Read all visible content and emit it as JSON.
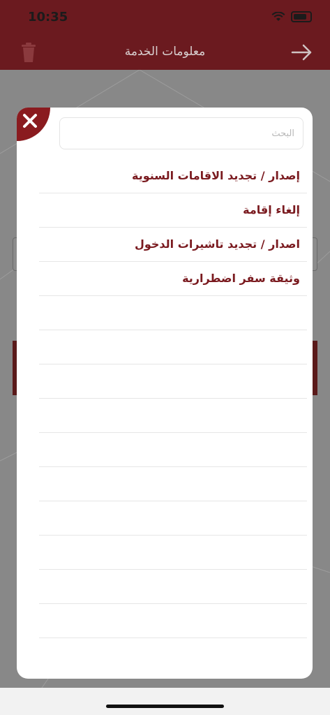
{
  "status_bar": {
    "time": "10:35"
  },
  "navbar": {
    "title": "معلومات الخدمة"
  },
  "modal": {
    "search_placeholder": "البحث",
    "items": [
      "إصدار / تجديد الاقامات السنوية",
      "إلغاء إقامة",
      "اصدار / تجديد تاشيرات الدخول",
      "وثيقة سفر اضطرارية",
      "",
      "",
      "",
      "",
      "",
      "",
      "",
      "",
      "",
      ""
    ]
  },
  "colors": {
    "brand": "#6b1a1f",
    "item_text": "#7a1a1f",
    "close_badge": "#8a1b1f"
  }
}
